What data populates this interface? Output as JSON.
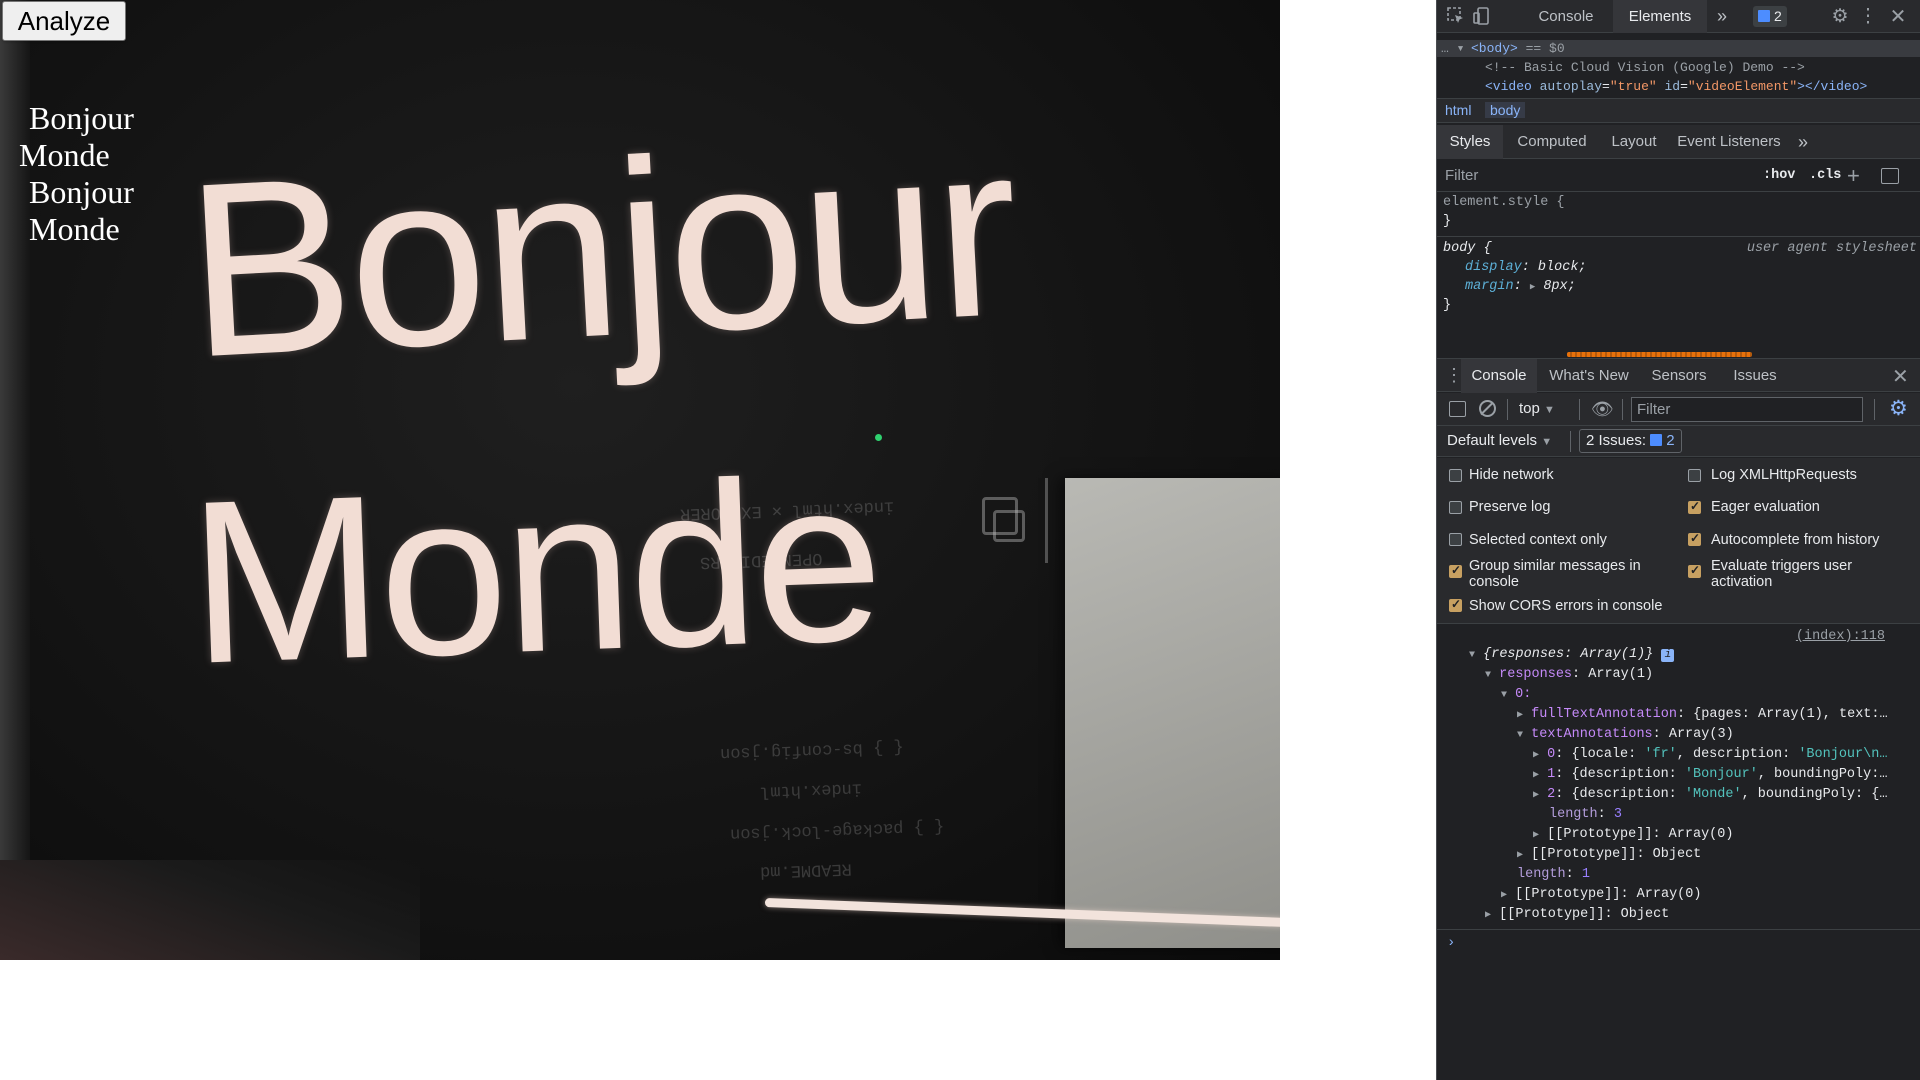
{
  "page": {
    "analyze_button": "Analyze",
    "results": [
      "Bonjour",
      "Monde",
      "Bonjour",
      "Monde"
    ],
    "camera_words": [
      "Bonjour",
      "Monde"
    ]
  },
  "devtools": {
    "tabs": [
      "Console",
      "Elements"
    ],
    "more": "»",
    "issues_count": "2",
    "dom": {
      "body_tag": "<body>",
      "body_eq": "== $0",
      "comment": "<!-- Basic Cloud Vision (Google) Demo -->",
      "video_open": "<video",
      "video_attr1": "autoplay",
      "video_val1": "\"true\"",
      "video_attr2": "id",
      "video_val2": "\"videoElement\"",
      "video_close": "></video>"
    },
    "breadcrumbs": [
      "html",
      "body"
    ],
    "styles_tabs": [
      "Styles",
      "Computed",
      "Layout",
      "Event Listeners"
    ],
    "styles_filter": "Filter",
    "hov": ":hov",
    "cls": ".cls",
    "styles": {
      "element_style": "element.style {",
      "close": "}",
      "body_sel": "body {",
      "ua": "user agent stylesheet",
      "prop1": "display",
      "val1": "block;",
      "prop2": "margin",
      "val2": "8px;"
    },
    "drawer_tabs": [
      "Console",
      "What's New",
      "Sensors",
      "Issues"
    ],
    "context": "top",
    "console_filter": "Filter",
    "default_levels": "Default levels",
    "issues_label": "2 Issues:",
    "issues_num": "2",
    "settings_left": [
      "Hide network",
      "Preserve log",
      "Selected context only",
      "Group similar messages in",
      "console",
      "Show CORS errors in console"
    ],
    "settings_right": [
      "Log XMLHttpRequests",
      "Eager evaluation",
      "Autocomplete from history",
      "Evaluate triggers user",
      "activation"
    ],
    "settings_checked": {
      "hide_network": false,
      "preserve_log": false,
      "selected_context": false,
      "group_similar": true,
      "show_cors": true,
      "log_xhr": false,
      "eager_eval": true,
      "autocomplete": true,
      "evaluate_triggers": true
    },
    "source_link": "(index):118",
    "console": {
      "l1": "{responses: Array(1)}",
      "l2k": "responses",
      "l2v": "Array(1)",
      "l3": "0:",
      "l4k": "fullTextAnnotation",
      "l4v": "{pages: Array(1), text:…",
      "l5k": "textAnnotations",
      "l5v": "Array(3)",
      "l6a": "0",
      "l6b": "{locale:",
      "l6c": "'fr'",
      "l6d": ", description:",
      "l6e": "'Bonjour\\n…",
      "l7a": "1",
      "l7b": "{description:",
      "l7c": "'Bonjour'",
      "l7d": ", boundingPoly:…",
      "l8a": "2",
      "l8b": "{description:",
      "l8c": "'Monde'",
      "l8d": ", boundingPoly: {…",
      "l9k": "length",
      "l9v": "3",
      "l10": "[[Prototype]]: Array(0)",
      "l11": "[[Prototype]]: Object",
      "l12k": "length",
      "l12v": "1",
      "l13": "[[Prototype]]: Array(0)",
      "l14": "[[Prototype]]: Object"
    },
    "prompt": "›"
  }
}
